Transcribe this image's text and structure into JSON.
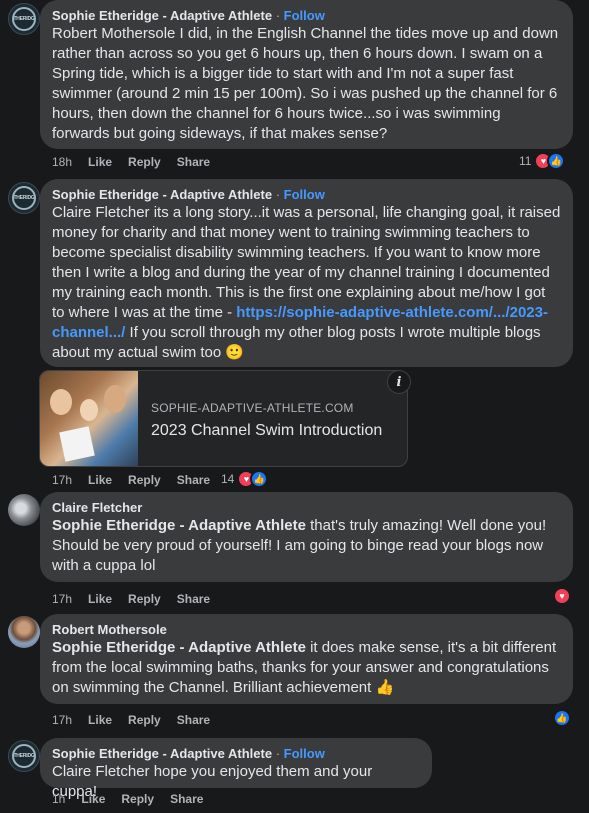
{
  "author_saa": "Sophie Etheridge - Adaptive Athlete",
  "follow_label": "Follow",
  "separator": "·",
  "like_label": "Like",
  "reply_label": "Reply",
  "share_label": "Share",
  "avatar_text": "ETHERIDGE",
  "comments": [
    {
      "time": "18h",
      "text": "Robert Mothersole I did, in the English Channel the tides move up and down rather than across so you get 6 hours up, then 6 hours down. I swam on a Spring tide, which is a bigger tide to start with and I'm not a super fast swimmer (around 2 min 15 per 100m). So i was pushed up the channel for 6 hours, then down the channel for 6 hours twice...so i was swimming forwards but going sideways, if that makes sense?",
      "reaction_count": "11"
    },
    {
      "time": "17h",
      "text_before_link": "Claire Fletcher its a long story...it was a personal, life changing goal, it raised money for charity and that money went to training swimming teachers to become specialist disability swimming teachers. If you want to know more then I write a blog and during the year of my channel training I documented my training each month. This is the first one explaining about me/how I got to where I was at the time - ",
      "link": "https://sophie-adaptive-athlete.com/.../2023-channel.../",
      "text_after_link": " If you scroll through my other blog posts I wrote multiple blogs about my actual swim too 🙂",
      "card_domain": "SOPHIE-ADAPTIVE-ATHLETE.COM",
      "card_title": "2023 Channel Swim Introduction",
      "reaction_count": "14"
    },
    {
      "author": "Claire Fletcher",
      "time": "17h",
      "tag": "Sophie Etheridge - Adaptive Athlete",
      "text": " that's truly amazing! Well done you! Should be very proud of yourself! I am going to binge read your blogs now with a cuppa lol"
    },
    {
      "author": "Robert Mothersole",
      "time": "17h",
      "tag": "Sophie Etheridge - Adaptive Athlete",
      "text": " it does make sense, it's a bit different from the local swimming baths, thanks for your answer and congratulations on swimming the Channel. Brilliant achievement 👍"
    },
    {
      "time": "1h",
      "text": "Claire Fletcher hope you enjoyed them and your cuppa!"
    }
  ],
  "colors": {
    "background": "#18191a",
    "bubble": "#3a3b3c",
    "link": "#4599ff",
    "love": "#f33e58",
    "like": "#1877f2"
  },
  "icons": {
    "love": "heart-icon",
    "like": "thumbs-up-icon",
    "info": "info-icon"
  }
}
